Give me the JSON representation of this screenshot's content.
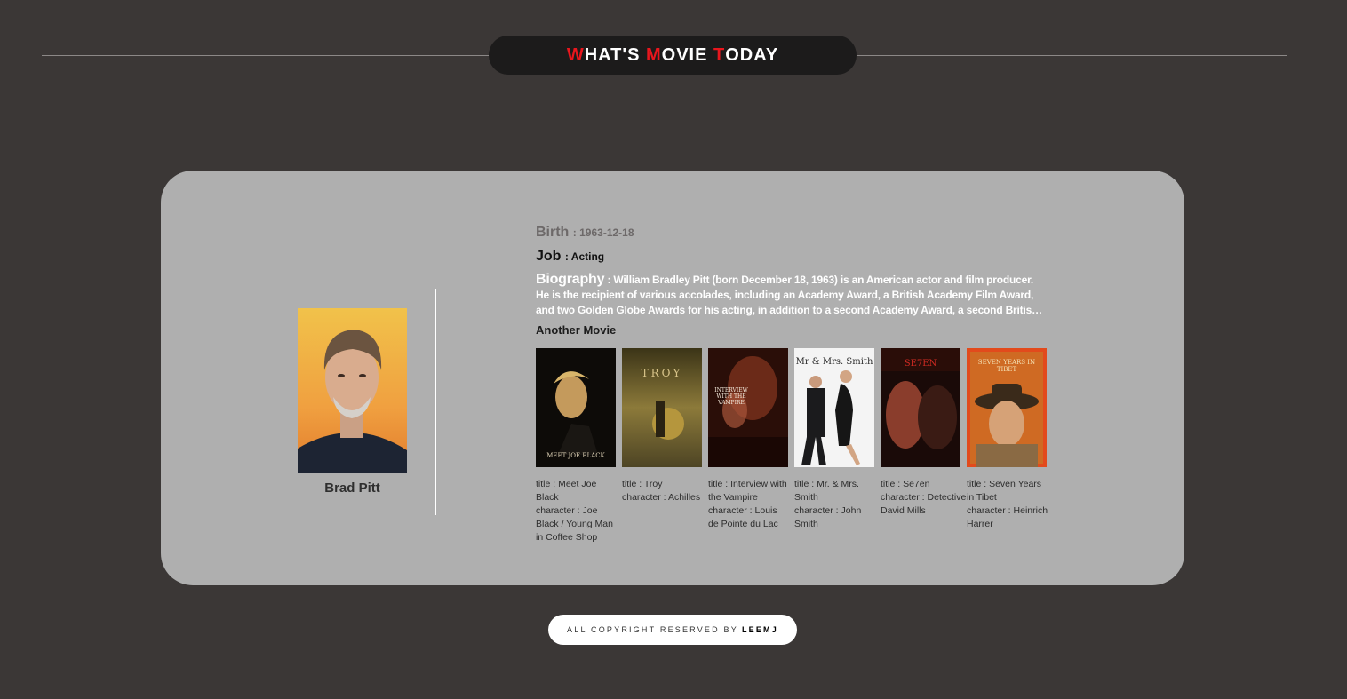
{
  "header": {
    "title_parts": [
      {
        "accent": "W",
        "rest": "HAT'S "
      },
      {
        "accent": "M",
        "rest": "OVIE "
      },
      {
        "accent": "T",
        "rest": "ODAY"
      }
    ]
  },
  "person": {
    "name": "Brad Pitt",
    "birth_label": "Birth",
    "birth": "1963-12-18",
    "job_label": "Job",
    "job": "Acting",
    "bio_label": "Biography",
    "bio": "William Bradley Pitt (born December 18, 1963) is an American actor and film producer. He is the recipient of various accolades, including an Academy Award, a British Academy Film Award, and two Golden Globe Awards for his acting, in addition to a second Academy Award, a second British Academy Film Award, a third Golden Globe Award, and a Primetime Emmy Award as a producer."
  },
  "another_movie_label": "Another Movie",
  "movies": [
    {
      "title": "Meet Joe Black",
      "character": "Joe Black / Young Man in Coffee Shop",
      "poster_text": "MEET JOE BLACK"
    },
    {
      "title": "Troy",
      "character": "Achilles",
      "poster_text": "TROY"
    },
    {
      "title": "Interview with the Vampire",
      "character": "Louis de Pointe du Lac",
      "poster_text": "INTERVIEW WITH THE VAMPIRE"
    },
    {
      "title": "Mr. & Mrs. Smith",
      "character": "John Smith",
      "poster_text": "Mr & Mrs. Smith"
    },
    {
      "title": "Se7en",
      "character": "Detective David Mills",
      "poster_text": "SE7EN"
    },
    {
      "title": "Seven Years in Tibet",
      "character": "Heinrich Harrer",
      "poster_text": "SEVEN YEARS IN TIBET"
    }
  ],
  "labels": {
    "title_prefix": "title : ",
    "character_prefix": "character : "
  },
  "footer": {
    "text": "ALL COPYRIGHT RESERVED BY",
    "author": "LEEMJ"
  },
  "colors": {
    "accent": "#e8161d",
    "background": "#3b3736",
    "card": "#afafaf"
  }
}
